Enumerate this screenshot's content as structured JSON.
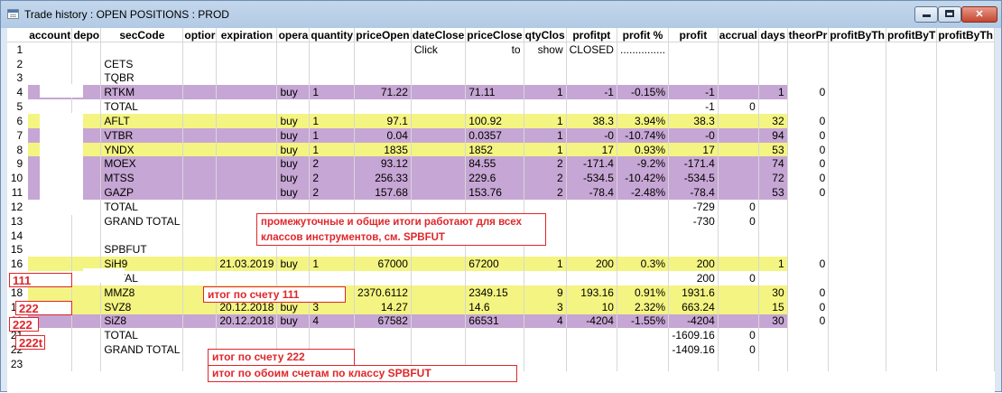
{
  "window": {
    "title": "Trade history : OPEN POSITIONS : PROD"
  },
  "columns": [
    "account",
    "depo",
    "secCode",
    "optior",
    "expiration",
    "opera",
    "quantity",
    "priceOpen",
    "dateClose",
    "priceClose",
    "qtyClos",
    "profitpt",
    "profit %",
    "profit",
    "accrual",
    "days",
    "theorPr",
    "profitByTh",
    "profitByT",
    "profitByTh"
  ],
  "row1": {
    "dateClose": "Click",
    "priceClose": "to",
    "qtyClose": "show",
    "profitpt": "CLOSED",
    "profitpct": "..............."
  },
  "rows": [
    {
      "n": "1",
      "hl": "",
      "cells": []
    },
    {
      "n": "2",
      "hl": "",
      "cells": [
        "",
        "",
        "CETS"
      ]
    },
    {
      "n": "3",
      "hl": "",
      "cells": [
        "",
        "",
        "TQBR"
      ]
    },
    {
      "n": "4",
      "hl": "p",
      "cells": [
        "",
        "",
        "RTKM",
        "",
        "",
        "buy",
        "1",
        "71.22",
        "",
        "71.11",
        "1",
        "-1",
        "-0.15%",
        "-1",
        "",
        "1",
        "0"
      ]
    },
    {
      "n": "5",
      "hl": "",
      "cells": [
        "",
        "",
        "TOTAL",
        "",
        "",
        "",
        "",
        "",
        "",
        "",
        "",
        "",
        "",
        "-1",
        "0"
      ]
    },
    {
      "n": "6",
      "hl": "y",
      "cells": [
        "",
        "",
        "AFLT",
        "",
        "",
        "buy",
        "1",
        "97.1",
        "",
        "100.92",
        "1",
        "38.3",
        "3.94%",
        "38.3",
        "",
        "32",
        "0"
      ]
    },
    {
      "n": "7",
      "hl": "p",
      "cells": [
        "",
        "",
        "VTBR",
        "",
        "",
        "buy",
        "1",
        "0.04",
        "",
        "0.0357",
        "1",
        "-0",
        "-10.74%",
        "-0",
        "",
        "94",
        "0"
      ]
    },
    {
      "n": "8",
      "hl": "y",
      "cells": [
        "",
        "",
        "YNDX",
        "",
        "",
        "buy",
        "1",
        "1835",
        "",
        "1852",
        "1",
        "17",
        "0.93%",
        "17",
        "",
        "53",
        "0"
      ]
    },
    {
      "n": "9",
      "hl": "p",
      "cells": [
        "",
        "",
        "MOEX",
        "",
        "",
        "buy",
        "2",
        "93.12",
        "",
        "84.55",
        "2",
        "-171.4",
        "-9.2%",
        "-171.4",
        "",
        "74",
        "0"
      ]
    },
    {
      "n": "10",
      "hl": "p",
      "cells": [
        "",
        "",
        "MTSS",
        "",
        "",
        "buy",
        "2",
        "256.33",
        "",
        "229.6",
        "2",
        "-534.5",
        "-10.42%",
        "-534.5",
        "",
        "72",
        "0"
      ]
    },
    {
      "n": "11",
      "hl": "p",
      "cells": [
        "",
        "",
        "GAZP",
        "",
        "",
        "buy",
        "2",
        "157.68",
        "",
        "153.76",
        "2",
        "-78.4",
        "-2.48%",
        "-78.4",
        "",
        "53",
        "0"
      ]
    },
    {
      "n": "12",
      "hl": "",
      "cells": [
        "",
        "",
        "TOTAL",
        "",
        "",
        "",
        "",
        "",
        "",
        "",
        "",
        "",
        "",
        "-729",
        "0"
      ]
    },
    {
      "n": "13",
      "hl": "",
      "cells": [
        "",
        "",
        "GRAND TOTAL",
        "",
        "",
        "",
        "",
        "",
        "",
        "",
        "",
        "",
        "",
        "-730",
        "0"
      ]
    },
    {
      "n": "14",
      "hl": "",
      "cells": []
    },
    {
      "n": "15",
      "hl": "",
      "cells": [
        "",
        "",
        "SPBFUT"
      ]
    },
    {
      "n": "16",
      "hl": "y",
      "cells": [
        "",
        "",
        "SiH9",
        "",
        "21.03.2019",
        "buy",
        "1",
        "67000",
        "",
        "67200",
        "1",
        "200",
        "0.3%",
        "200",
        "",
        "1",
        "0"
      ]
    },
    {
      "n": "17",
      "hl": "",
      "cells": [
        "",
        "",
        "TOTAL",
        "",
        "",
        "",
        "",
        "",
        "",
        "",
        "",
        "",
        "",
        "200",
        "0"
      ]
    },
    {
      "n": "18",
      "hl": "y",
      "cells": [
        "",
        "",
        "MMZ8",
        "",
        "20.12.2018",
        "sell",
        "9",
        "2370.6112",
        "",
        "2349.15",
        "9",
        "193.16",
        "0.91%",
        "1931.6",
        "",
        "30",
        "0"
      ]
    },
    {
      "n": "19",
      "hl": "y",
      "cells": [
        "",
        "",
        "SVZ8",
        "",
        "20.12.2018",
        "buy",
        "3",
        "14.27",
        "",
        "14.6",
        "3",
        "10",
        "2.32%",
        "663.24",
        "",
        "15",
        "0"
      ]
    },
    {
      "n": "20",
      "hl": "p",
      "cells": [
        "",
        "",
        "SiZ8",
        "",
        "20.12.2018",
        "buy",
        "4",
        "67582",
        "",
        "66531",
        "4",
        "-4204",
        "-1.55%",
        "-4204",
        "",
        "30",
        "0"
      ]
    },
    {
      "n": "21",
      "hl": "",
      "cells": [
        "",
        "",
        "TOTAL",
        "",
        "",
        "",
        "",
        "",
        "",
        "",
        "",
        "",
        "",
        "-1609.16",
        "0"
      ]
    },
    {
      "n": "22",
      "hl": "",
      "cells": [
        "",
        "",
        "GRAND TOTAL",
        "",
        "",
        "",
        "",
        "",
        "",
        "",
        "",
        "",
        "",
        "-1409.16",
        "0"
      ]
    },
    {
      "n": "23",
      "hl": "",
      "cells": []
    }
  ],
  "accounts": [
    "111",
    "222",
    "222",
    "222t"
  ],
  "annotations": {
    "a1": "промежуточные и общие итоги работают для всех",
    "a2": "классов инструментов, см. SPBFUT",
    "a3": "итог по счету 111",
    "a4": "итог по счету 222",
    "a5": "итог по обоим счетам по классу SPBFUT"
  }
}
